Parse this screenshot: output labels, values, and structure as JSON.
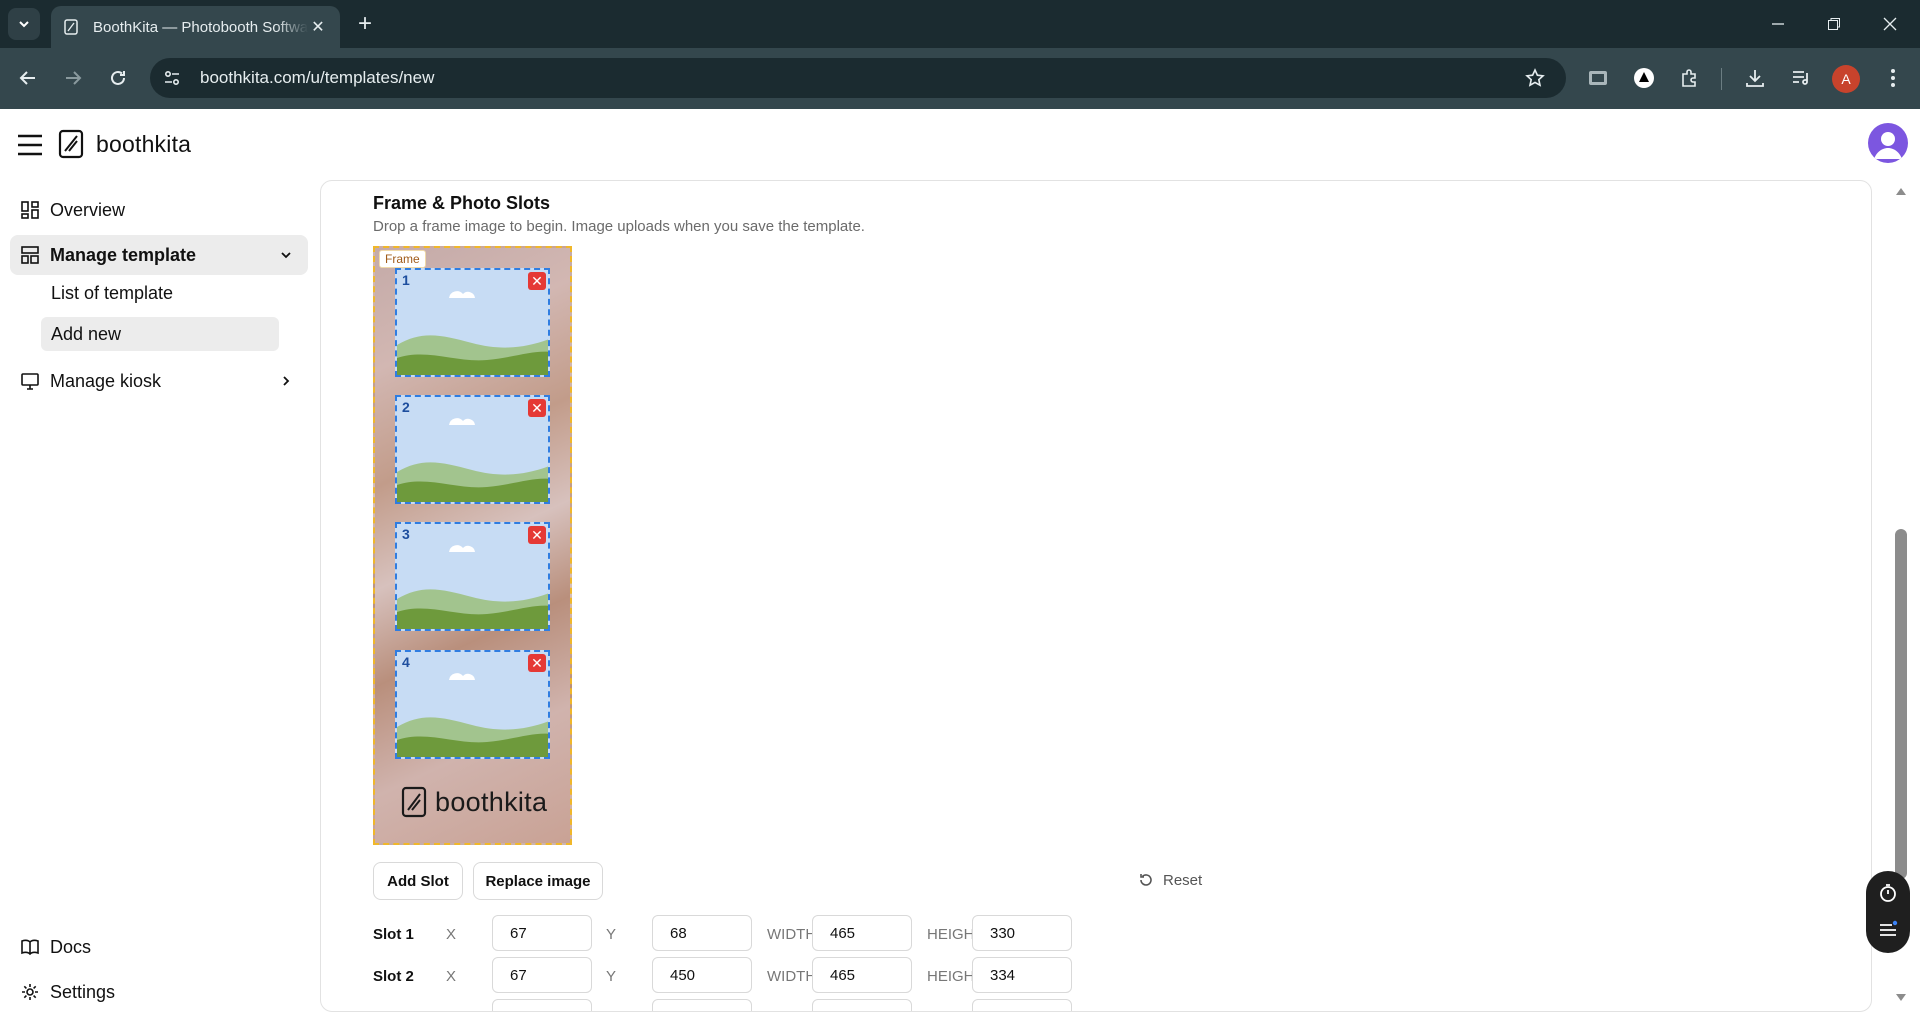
{
  "browser": {
    "tab_title": "BoothKita — Photobooth Software",
    "url": "boothkita.com/u/templates/new",
    "profile_initial": "A"
  },
  "app": {
    "brand": "boothkita"
  },
  "sidebar": {
    "overview": "Overview",
    "manage_template": "Manage template",
    "list_of_template": "List of template",
    "add_new": "Add new",
    "manage_kiosk": "Manage kiosk",
    "docs": "Docs",
    "settings": "Settings"
  },
  "main": {
    "section_title": "Frame & Photo Slots",
    "section_subtitle": "Drop a frame image to begin. Image uploads when you save the template.",
    "frame_tag": "Frame",
    "frame_logo_text": "boothkita",
    "slots_preview": [
      {
        "number": "1"
      },
      {
        "number": "2"
      },
      {
        "number": "3"
      },
      {
        "number": "4"
      }
    ],
    "add_slot_label": "Add Slot",
    "replace_image_label": "Replace image",
    "reset_label": "Reset",
    "coord_labels": {
      "x": "X",
      "y": "Y",
      "width": "WIDTH",
      "height": "HEIGHT"
    },
    "slot_rows": [
      {
        "label": "Slot 1",
        "x": "67",
        "y": "68",
        "width": "465",
        "height": "330"
      },
      {
        "label": "Slot 2",
        "x": "67",
        "y": "450",
        "width": "465",
        "height": "334"
      }
    ]
  }
}
